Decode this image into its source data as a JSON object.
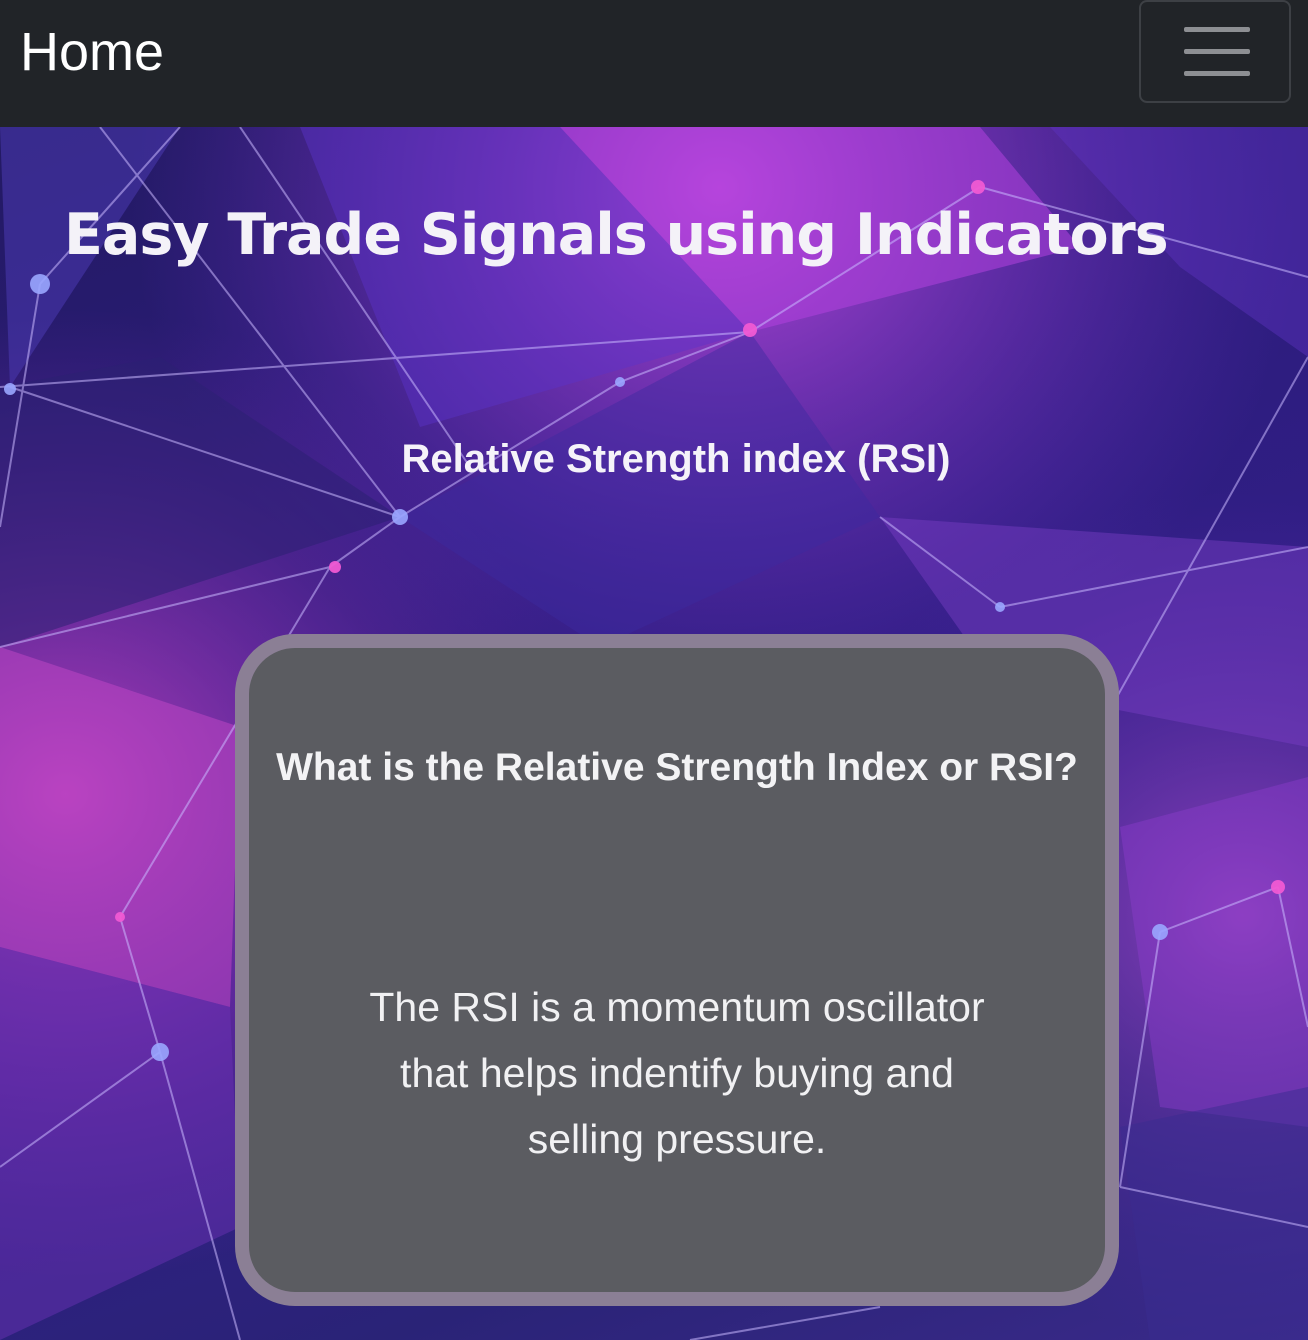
{
  "navbar": {
    "brand": "Home",
    "toggle_icon": "hamburger-menu-icon"
  },
  "hero": {
    "title": "Easy Trade Signals using Indicators",
    "subtitle": "Relative Strength index (RSI)"
  },
  "card": {
    "title": "What is the Relative Strength Index or RSI?",
    "text": "The RSI is a momentum oscillator that helps indentify buying and selling pressure."
  },
  "colors": {
    "navbar_bg": "#212428",
    "card_bg": "#5b5c61",
    "card_border": "#8b7f95",
    "accent_magenta": "#d34fd6",
    "accent_blue": "#3f48c8"
  }
}
